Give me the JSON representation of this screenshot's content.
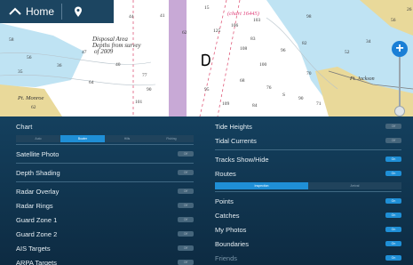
{
  "topbar": {
    "home_label": "Home"
  },
  "map": {
    "labels": [
      "Disposal Area",
      "Depths from survey",
      "of 2009",
      "Pt. Monroe",
      "(chart 16445)",
      "Pt. Jackson"
    ],
    "soundings": [
      "44",
      "41",
      "15",
      "106",
      "103",
      "98",
      "56",
      "35",
      "36",
      "47",
      "62",
      "83",
      "96",
      "70",
      "125",
      "108",
      "100",
      "68",
      "76",
      "82",
      "40",
      "64",
      "77",
      "90",
      "101",
      "109",
      "84",
      "90",
      "71",
      "52",
      "34",
      "56",
      "26",
      "62",
      "58",
      "95",
      "S"
    ]
  },
  "left_panel": {
    "chart_label": "Chart",
    "chart_modes": [
      "Auto",
      "Boater",
      "Hills",
      "Fishing"
    ],
    "chart_mode_selected": 1,
    "items": [
      {
        "label": "Satellite Photo",
        "state": "Off"
      },
      {
        "label": "Depth Shading",
        "state": "Off"
      },
      {
        "label": "Radar Overlay",
        "state": "Off"
      },
      {
        "label": "Radar Rings",
        "state": "Off"
      },
      {
        "label": "Guard Zone 1",
        "state": "Off"
      },
      {
        "label": "Guard Zone 2",
        "state": "Off"
      },
      {
        "label": "AIS Targets",
        "state": "Off"
      },
      {
        "label": "ARPA Targets",
        "state": "Off"
      }
    ]
  },
  "right_panel": {
    "tide_heights": {
      "label": "Tide Heights",
      "state": "Off"
    },
    "tidal_currents": {
      "label": "Tidal Currents",
      "state": "Off"
    },
    "tracks": {
      "label": "Tracks Show/Hide",
      "state": "On"
    },
    "routes": {
      "label": "Routes",
      "state": "On"
    },
    "route_modes": [
      "Inspection",
      "Arrival"
    ],
    "route_mode_selected": 0,
    "items": [
      {
        "label": "Points",
        "state": "On"
      },
      {
        "label": "Catches",
        "state": "On"
      },
      {
        "label": "My Photos",
        "state": "On"
      },
      {
        "label": "Boundaries",
        "state": "On"
      },
      {
        "label": "Friends",
        "state": "On"
      }
    ]
  },
  "colors": {
    "accent": "#1f8fd6",
    "panel_bg": "#14405e",
    "land": "#e9d99a",
    "shallow_water": "#bfe3f3",
    "deep_water": "#ffffff",
    "channel": "#c8a9d6"
  }
}
